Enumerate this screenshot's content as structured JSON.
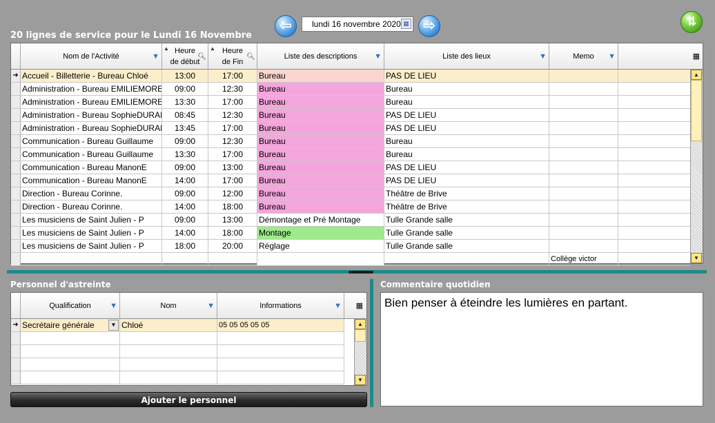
{
  "header": {
    "date_value": "lundi 16 novembre 2020",
    "title": "20 lignes de service pour le Lundi 16 Novembre"
  },
  "icons": {
    "prev": "arrow-left-icon",
    "next": "arrow-right-icon",
    "refresh": "refresh-arrows-icon",
    "calendar": "calendar-icon",
    "filter": "filter-icon",
    "columns": "column-chooser-icon"
  },
  "colors": {
    "selected_row": "#fbeecb",
    "bureau": "#f4a6dc",
    "montage": "#9eea8c",
    "accueil_bureau": "#fbd6d0",
    "teal_divider": "#1f8a8a"
  },
  "grid": {
    "columns": {
      "activite": "Nom de l'Activité",
      "debut_1": "Heure",
      "debut_2": "de début",
      "fin_1": "Heure",
      "fin_2": "de Fin",
      "descriptions": "Liste des descriptions",
      "lieux": "Liste des lieux",
      "memo": "Memo"
    },
    "rows": [
      {
        "activite": "Accueil - Billetterie - Bureau Chloé",
        "debut": "13:00",
        "fin": "17:00",
        "description": "Bureau",
        "lieu": "PAS DE LIEU",
        "memo": "",
        "desc_color": "#fbd6d0"
      },
      {
        "activite": "Administration - Bureau EMILIEMORE",
        "debut": "09:00",
        "fin": "12:30",
        "description": "Bureau",
        "lieu": "Bureau",
        "memo": "",
        "desc_color": "#f4a6dc"
      },
      {
        "activite": "Administration - Bureau EMILIEMORE",
        "debut": "13:30",
        "fin": "17:00",
        "description": "Bureau",
        "lieu": "Bureau",
        "memo": "",
        "desc_color": "#f4a6dc"
      },
      {
        "activite": "Administration - Bureau SophieDURAND",
        "debut": "08:45",
        "fin": "12:30",
        "description": "Bureau",
        "lieu": "PAS DE LIEU",
        "memo": "",
        "desc_color": "#f4a6dc"
      },
      {
        "activite": "Administration - Bureau SophieDURAND",
        "debut": "13:45",
        "fin": "17:00",
        "description": "Bureau",
        "lieu": "PAS DE LIEU",
        "memo": "",
        "desc_color": "#f4a6dc"
      },
      {
        "activite": "Communication - Bureau Guillaume",
        "debut": "09:00",
        "fin": "12:30",
        "description": "Bureau",
        "lieu": "Bureau",
        "memo": "",
        "desc_color": "#f4a6dc"
      },
      {
        "activite": "Communication - Bureau Guillaume",
        "debut": "13:30",
        "fin": "17:00",
        "description": "Bureau",
        "lieu": "Bureau",
        "memo": "",
        "desc_color": "#f4a6dc"
      },
      {
        "activite": "Communication - Bureau ManonE",
        "debut": "09:00",
        "fin": "13:00",
        "description": "Bureau",
        "lieu": "PAS DE LIEU",
        "memo": "",
        "desc_color": "#f4a6dc"
      },
      {
        "activite": "Communication - Bureau ManonE",
        "debut": "14:00",
        "fin": "17:00",
        "description": "Bureau",
        "lieu": "PAS DE LIEU",
        "memo": "",
        "desc_color": "#f4a6dc"
      },
      {
        "activite": "Direction - Bureau Corinne.",
        "debut": "09:00",
        "fin": "12:00",
        "description": "Bureau",
        "lieu": "Théâtre de Brive",
        "memo": "",
        "desc_color": "#f4a6dc"
      },
      {
        "activite": "Direction - Bureau Corinne.",
        "debut": "14:00",
        "fin": "18:00",
        "description": "Bureau",
        "lieu": "Théâtre de Brive",
        "memo": "",
        "desc_color": "#f4a6dc"
      },
      {
        "activite": "Les musiciens de Saint Julien - P",
        "debut": "09:00",
        "fin": "13:00",
        "description": "Démontage et Pré Montage",
        "lieu": "Tulle Grande salle",
        "memo": "",
        "desc_color": "#ffffff"
      },
      {
        "activite": "Les musiciens de Saint Julien - P",
        "debut": "14:00",
        "fin": "18:00",
        "description": "Montage",
        "lieu": "Tulle Grande salle",
        "memo": "",
        "desc_color": "#9eea8c"
      },
      {
        "activite": "Les musiciens de Saint Julien - P",
        "debut": "18:00",
        "fin": "20:00",
        "description": "Réglage",
        "lieu": "Tulle Grande salle",
        "memo": "",
        "desc_color": "#ffffff"
      },
      {
        "activite": "",
        "debut": "",
        "fin": "",
        "description": "",
        "lieu": "",
        "memo": "Collège victor",
        "desc_color": "#ffffff"
      }
    ]
  },
  "astreinte": {
    "label": "Personnel d'astreinte",
    "columns": {
      "qualification": "Qualification",
      "nom": "Nom",
      "informations": "Informations"
    },
    "rows": [
      {
        "qualification": "Secrétaire générale",
        "nom": "Chloé",
        "informations": "05 05 05 05 05"
      }
    ],
    "add_button": "Ajouter le personnel"
  },
  "commentaire": {
    "label": "Commentaire quotidien",
    "text": "Bien penser à éteindre les lumières en partant."
  }
}
